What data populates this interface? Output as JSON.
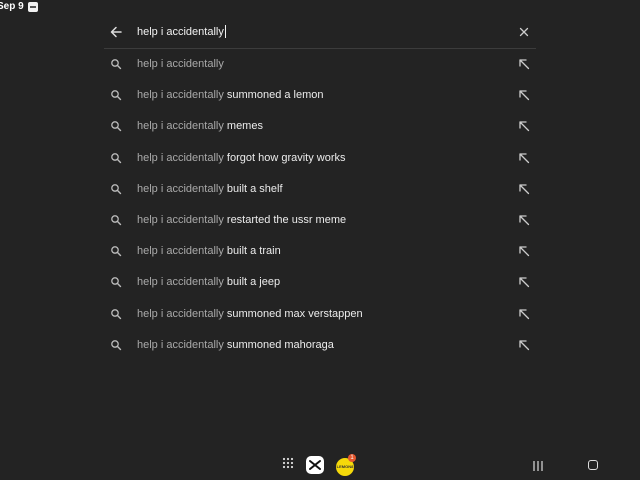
{
  "status": {
    "date": "Sep 9"
  },
  "search": {
    "query": "help i accidentally",
    "back_icon": "arrow-left-icon",
    "clear_icon": "close-icon"
  },
  "suggestions": [
    {
      "prefix": "help i accidentally",
      "rest": ""
    },
    {
      "prefix": "help i accidentally",
      "rest": " summoned a lemon"
    },
    {
      "prefix": "help i accidentally",
      "rest": " memes"
    },
    {
      "prefix": "help i accidentally",
      "rest": " forgot how gravity works"
    },
    {
      "prefix": "help i accidentally",
      "rest": " built a shelf"
    },
    {
      "prefix": "help i accidentally",
      "rest": " restarted the ussr meme"
    },
    {
      "prefix": "help i accidentally",
      "rest": " built a train"
    },
    {
      "prefix": "help i accidentally",
      "rest": " built a jeep"
    },
    {
      "prefix": "help i accidentally",
      "rest": " summoned max verstappen"
    },
    {
      "prefix": "help i accidentally",
      "rest": " summoned mahoraga"
    }
  ],
  "dock": {
    "badge_count": "1",
    "app_label": "LEMON8"
  },
  "colors": {
    "background": "#232323",
    "text": "#ececec",
    "muted": "#a9a9a9"
  }
}
